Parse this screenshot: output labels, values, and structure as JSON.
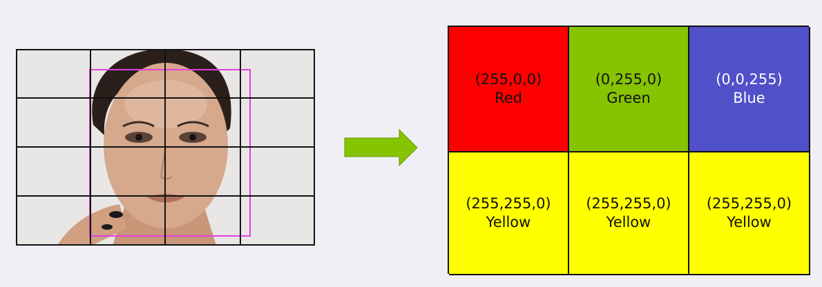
{
  "arrow": {
    "color": "#86c300"
  },
  "photo": {
    "grid_rows": 4,
    "grid_cols": 4,
    "face_box_color": "#e040e0"
  },
  "cells": [
    {
      "rgb": "(255,0,0)",
      "name": "Red",
      "bg": "#ff0000",
      "fg": "#111111"
    },
    {
      "rgb": "(0,255,0)",
      "name": "Green",
      "bg": "#86c300",
      "fg": "#111111"
    },
    {
      "rgb": "(0,0,255)",
      "name": "Blue",
      "bg": "#5050c8",
      "fg": "#ffffff"
    },
    {
      "rgb": "(255,255,0)",
      "name": "Yellow",
      "bg": "#ffff00",
      "fg": "#111111"
    },
    {
      "rgb": "(255,255,0)",
      "name": "Yellow",
      "bg": "#ffff00",
      "fg": "#111111"
    },
    {
      "rgb": "(255,255,0)",
      "name": "Yellow",
      "bg": "#ffff00",
      "fg": "#111111"
    }
  ]
}
